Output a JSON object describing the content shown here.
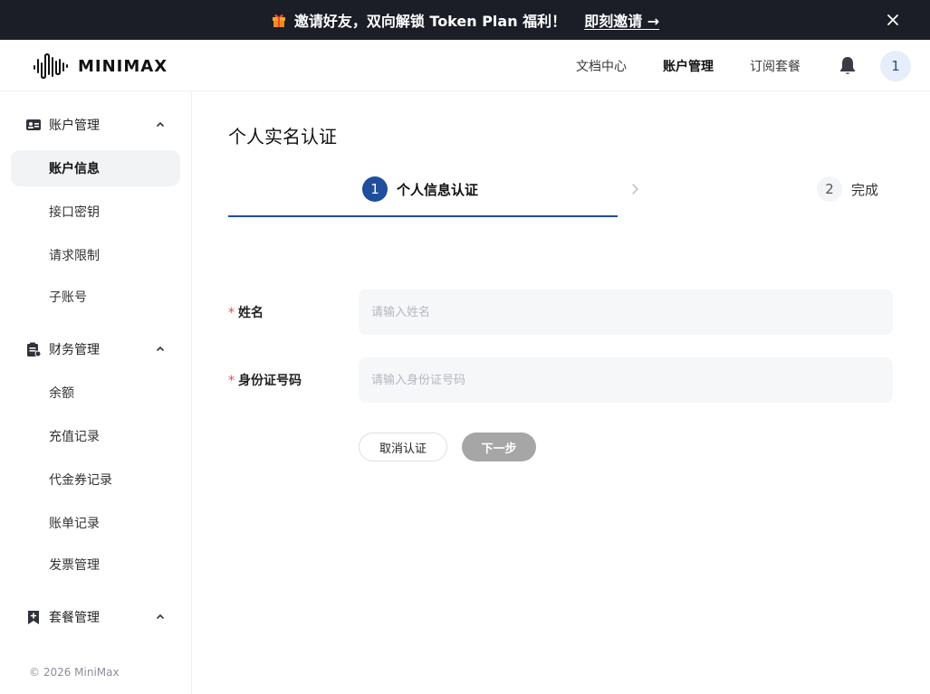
{
  "banner": {
    "text": "邀请好友，双向解锁 Token Plan 福利！",
    "link": "即刻邀请 →",
    "gift_icon": "gift-icon",
    "close_icon": "close-icon"
  },
  "header": {
    "logo_text": "MINIMAX",
    "nav": [
      "文档中心",
      "账户管理",
      "订阅套餐"
    ],
    "active_nav": "账户管理",
    "avatar_text": "1"
  },
  "sidebar": {
    "groups": [
      {
        "label": "账户管理",
        "icon": "id-card-icon",
        "items": [
          "账户信息",
          "接口密钥",
          "请求限制",
          "子账号"
        ]
      },
      {
        "label": "财务管理",
        "icon": "clipboard-icon",
        "items": [
          "余额",
          "充值记录",
          "代金券记录",
          "账单记录",
          "发票管理"
        ]
      },
      {
        "label": "套餐管理",
        "icon": "bookmark-plus-icon",
        "items": []
      }
    ],
    "active_item": "账户信息",
    "copyright": "© 2026 MiniMax"
  },
  "main": {
    "title": "个人实名认证",
    "steps": [
      {
        "num": "1",
        "label": "个人信息认证"
      },
      {
        "num": "2",
        "label": "完成"
      }
    ],
    "form": {
      "name_label": "姓名",
      "name_placeholder": "请输入姓名",
      "id_label": "身份证号码",
      "id_placeholder": "请输入身份证号码",
      "required_mark": "*"
    },
    "buttons": {
      "cancel": "取消认证",
      "next": "下一步"
    }
  },
  "colors": {
    "banner_bg": "#1b1e26",
    "accent": "#1f4e9c",
    "required": "#e5484d",
    "next_disabled": "#a6a6a6"
  }
}
